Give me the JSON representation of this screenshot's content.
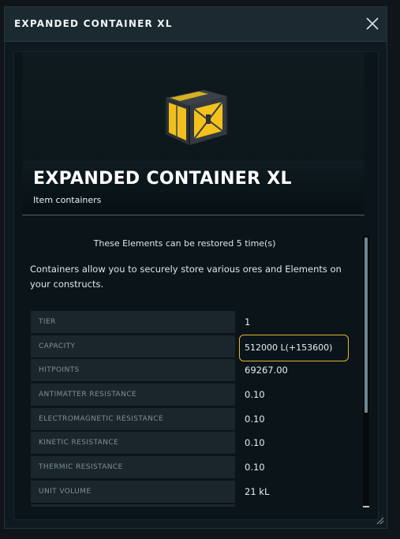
{
  "window": {
    "title": "EXPANDED CONTAINER XL",
    "close_icon": "close-icon"
  },
  "item": {
    "name": "EXPANDED CONTAINER XL",
    "category": "Item containers",
    "image_icon": "container-crate-icon"
  },
  "restore_text": "These Elements can be restored 5 time(s)",
  "description": "Containers allow you to securely store various ores and Elements on your constructs.",
  "stats": [
    {
      "label": "TIER",
      "value": "1"
    },
    {
      "label": "CAPACITY",
      "value": "512000 L(+153600)"
    },
    {
      "label": "HITPOINTS",
      "value": "69267.00"
    },
    {
      "label": "ANTIMATTER RESISTANCE",
      "value": "0.10"
    },
    {
      "label": "ELECTROMAGNETIC RESISTANCE",
      "value": "0.10"
    },
    {
      "label": "KINETIC RESISTANCE",
      "value": "0.10"
    },
    {
      "label": "THERMIC RESISTANCE",
      "value": "0.10"
    },
    {
      "label": "UNIT VOLUME",
      "value": "21 kL"
    }
  ],
  "colors": {
    "highlight": "#e2b636",
    "crate_yellow": "#f3c21c",
    "crate_dark": "#343a3f"
  }
}
